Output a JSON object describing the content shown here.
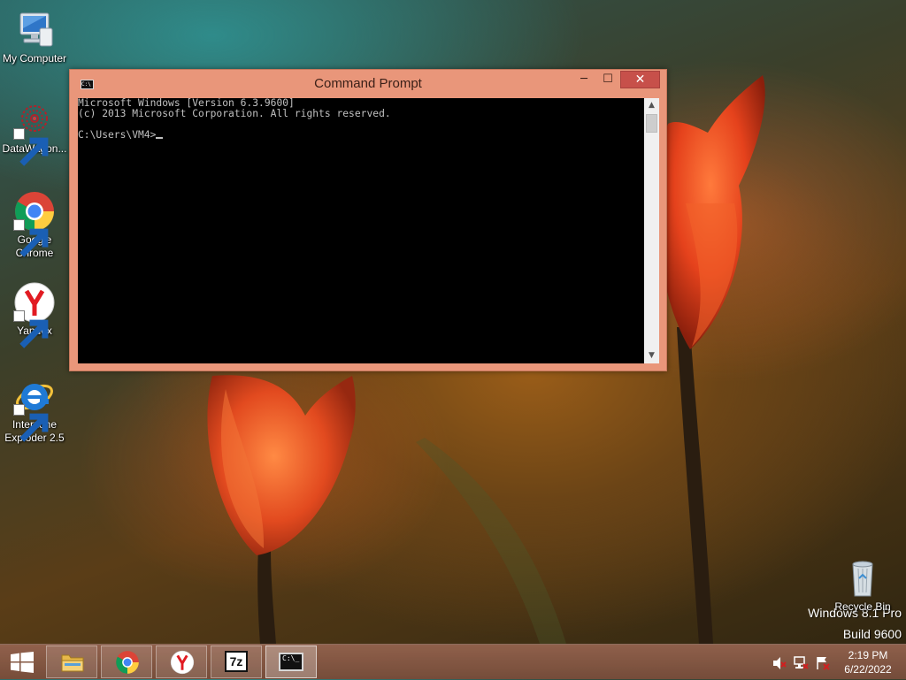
{
  "desktop": {
    "icons": [
      {
        "label": "My Computer",
        "icon": "my-computer-icon"
      },
      {
        "label": "DataWagon...",
        "icon": "datawagon-icon"
      },
      {
        "label": "Google Chrome",
        "icon": "chrome-icon"
      },
      {
        "label": "Yandex",
        "icon": "yandex-icon"
      },
      {
        "label": "Interzone Exploder 2.5",
        "icon": "internet-explorer-icon"
      },
      {
        "label": "Recycle Bin",
        "icon": "recycle-bin-icon"
      }
    ]
  },
  "window": {
    "title": "Command Prompt",
    "buttons": {
      "minimize": "─",
      "maximize": "☐",
      "close": "✕"
    },
    "console": {
      "lines": [
        "Microsoft Windows [Version 6.3.9600]",
        "(c) 2013 Microsoft Corporation. All rights reserved.",
        "",
        "C:\\Users\\VM4>"
      ]
    }
  },
  "watermark": {
    "edition": "Windows 8.1 Pro",
    "build": "Build 9600"
  },
  "taskbar": {
    "pinned": [
      {
        "name": "file-explorer",
        "icon": "folder-icon"
      },
      {
        "name": "chrome",
        "icon": "chrome-icon"
      },
      {
        "name": "yandex",
        "icon": "yandex-icon"
      },
      {
        "name": "7zip",
        "icon": "7zip-icon",
        "label": "7z"
      },
      {
        "name": "command-prompt",
        "icon": "cmd-icon",
        "active": true
      }
    ],
    "tray": {
      "icons": [
        "volume-muted-icon",
        "network-icon",
        "action-center-icon"
      ],
      "time": "2:19 PM",
      "date": "6/22/2022"
    }
  },
  "colors": {
    "window_frame": "#e9967a",
    "close_button": "#c7504a",
    "console_bg": "#000000",
    "console_text": "#c0c0c0"
  }
}
